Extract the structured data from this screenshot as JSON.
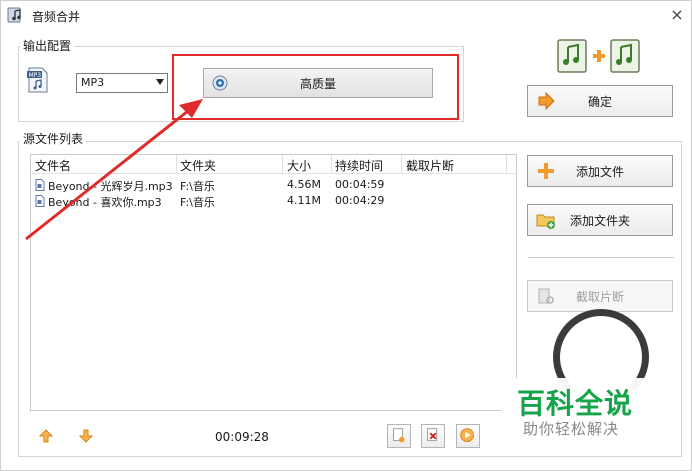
{
  "window": {
    "title": "音频合并",
    "close_label": "×"
  },
  "output": {
    "group_label": "输出配置",
    "format_selected": "MP3",
    "quality_button": "高质量",
    "mp3_icon_text": "MP3"
  },
  "actions": {
    "confirm": "确定",
    "add_file": "添加文件",
    "add_folder": "添加文件夹",
    "cut_clip": "截取片断"
  },
  "source": {
    "group_label": "源文件列表",
    "columns": [
      "文件名",
      "文件夹",
      "大小",
      "持续时间",
      "截取片断"
    ],
    "rows": [
      {
        "name": "Beyond - 光辉岁月.mp3",
        "folder": "F:\\音乐",
        "size": "4.56M",
        "duration": "00:04:59",
        "clip": ""
      },
      {
        "name": "Beyond - 喜欢你.mp3",
        "folder": "F:\\音乐",
        "size": "4.11M",
        "duration": "00:04:29",
        "clip": ""
      }
    ]
  },
  "footer": {
    "total_time": "00:09:28"
  },
  "watermark": {
    "title": "百科全说",
    "subtitle": "助你轻松解决"
  },
  "colors": {
    "highlight": "#e02b2b",
    "watermark_green": "#17a34a",
    "accent_orange": "#f29a2e"
  },
  "icons": [
    "app-icon",
    "mp3-file-icon",
    "quality-icon",
    "music-merge-logo",
    "arrow-right-icon",
    "plus-icon",
    "folder-add-icon",
    "cut-icon",
    "move-up-icon",
    "move-down-icon",
    "file-icon"
  ]
}
